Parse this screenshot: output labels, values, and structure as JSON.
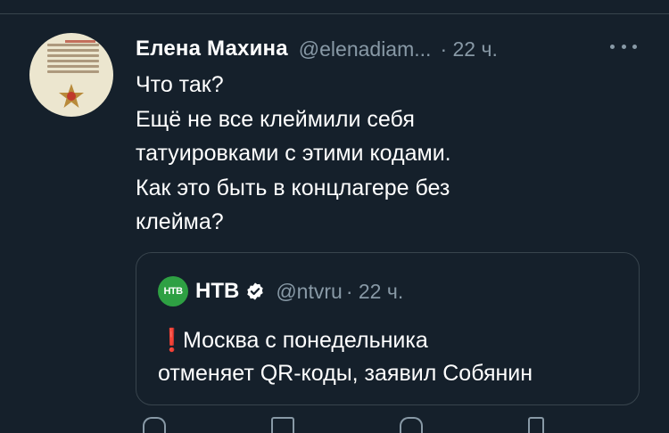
{
  "tweet": {
    "author_name": "Елена  Махина",
    "handle": "@elenadiam...",
    "time": "· 22 ч.",
    "text_lines": [
      "Что так?",
      "Ещё не все клеймили себя",
      "татуировками с этими кодами.",
      "Как это быть в концлагере без",
      "клейма?"
    ]
  },
  "quoted": {
    "logo_text": "НТВ",
    "author_name": "НТВ",
    "handle": "@ntvru",
    "time": "· 22 ч.",
    "exclaim": "❗",
    "text_lines": [
      "Москва с понедельника",
      "отменяет QR-коды, заявил Собянин"
    ]
  },
  "colors": {
    "background": "#15202b",
    "secondary_text": "#8899a6",
    "border": "#38444d",
    "verified_badge": "#ffffff",
    "ntv_logo": "#2ea043"
  },
  "icons": [
    "more-icon",
    "verified-icon",
    "reply-icon",
    "retweet-icon",
    "like-icon",
    "share-icon"
  ]
}
